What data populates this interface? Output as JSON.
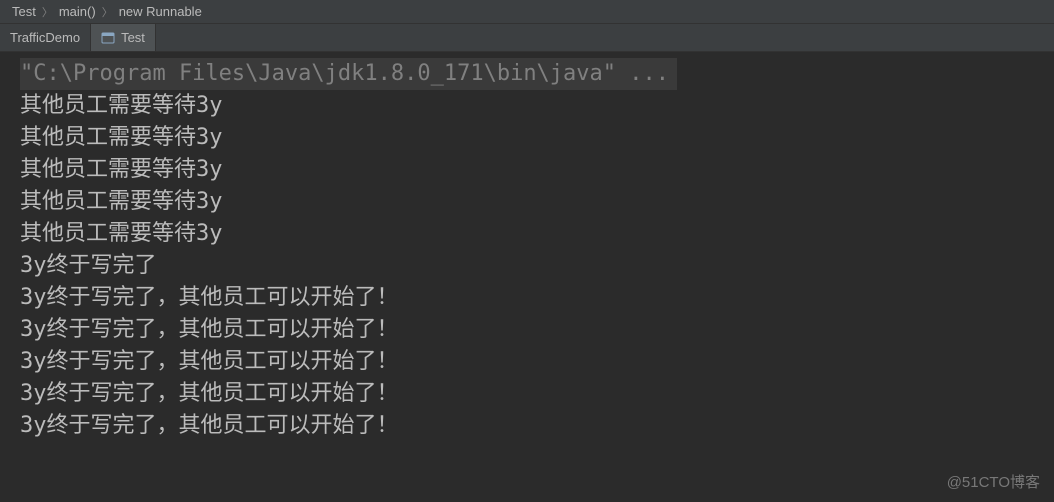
{
  "breadcrumb": {
    "items": [
      "Test",
      "main()",
      "new Runnable"
    ]
  },
  "tabs": [
    {
      "label": "TrafficDemo",
      "active": false,
      "icon": "none"
    },
    {
      "label": "Test",
      "active": true,
      "icon": "application"
    }
  ],
  "console": {
    "command": "\"C:\\Program Files\\Java\\jdk1.8.0_171\\bin\\java\" ...",
    "lines": [
      "其他员工需要等待3y",
      "其他员工需要等待3y",
      "其他员工需要等待3y",
      "其他员工需要等待3y",
      "其他员工需要等待3y",
      "3y终于写完了",
      "3y终于写完了，其他员工可以开始了！",
      "3y终于写完了，其他员工可以开始了！",
      "3y终于写完了，其他员工可以开始了！",
      "3y终于写完了，其他员工可以开始了！",
      "3y终于写完了，其他员工可以开始了！"
    ]
  },
  "watermark": "@51CTO博客"
}
